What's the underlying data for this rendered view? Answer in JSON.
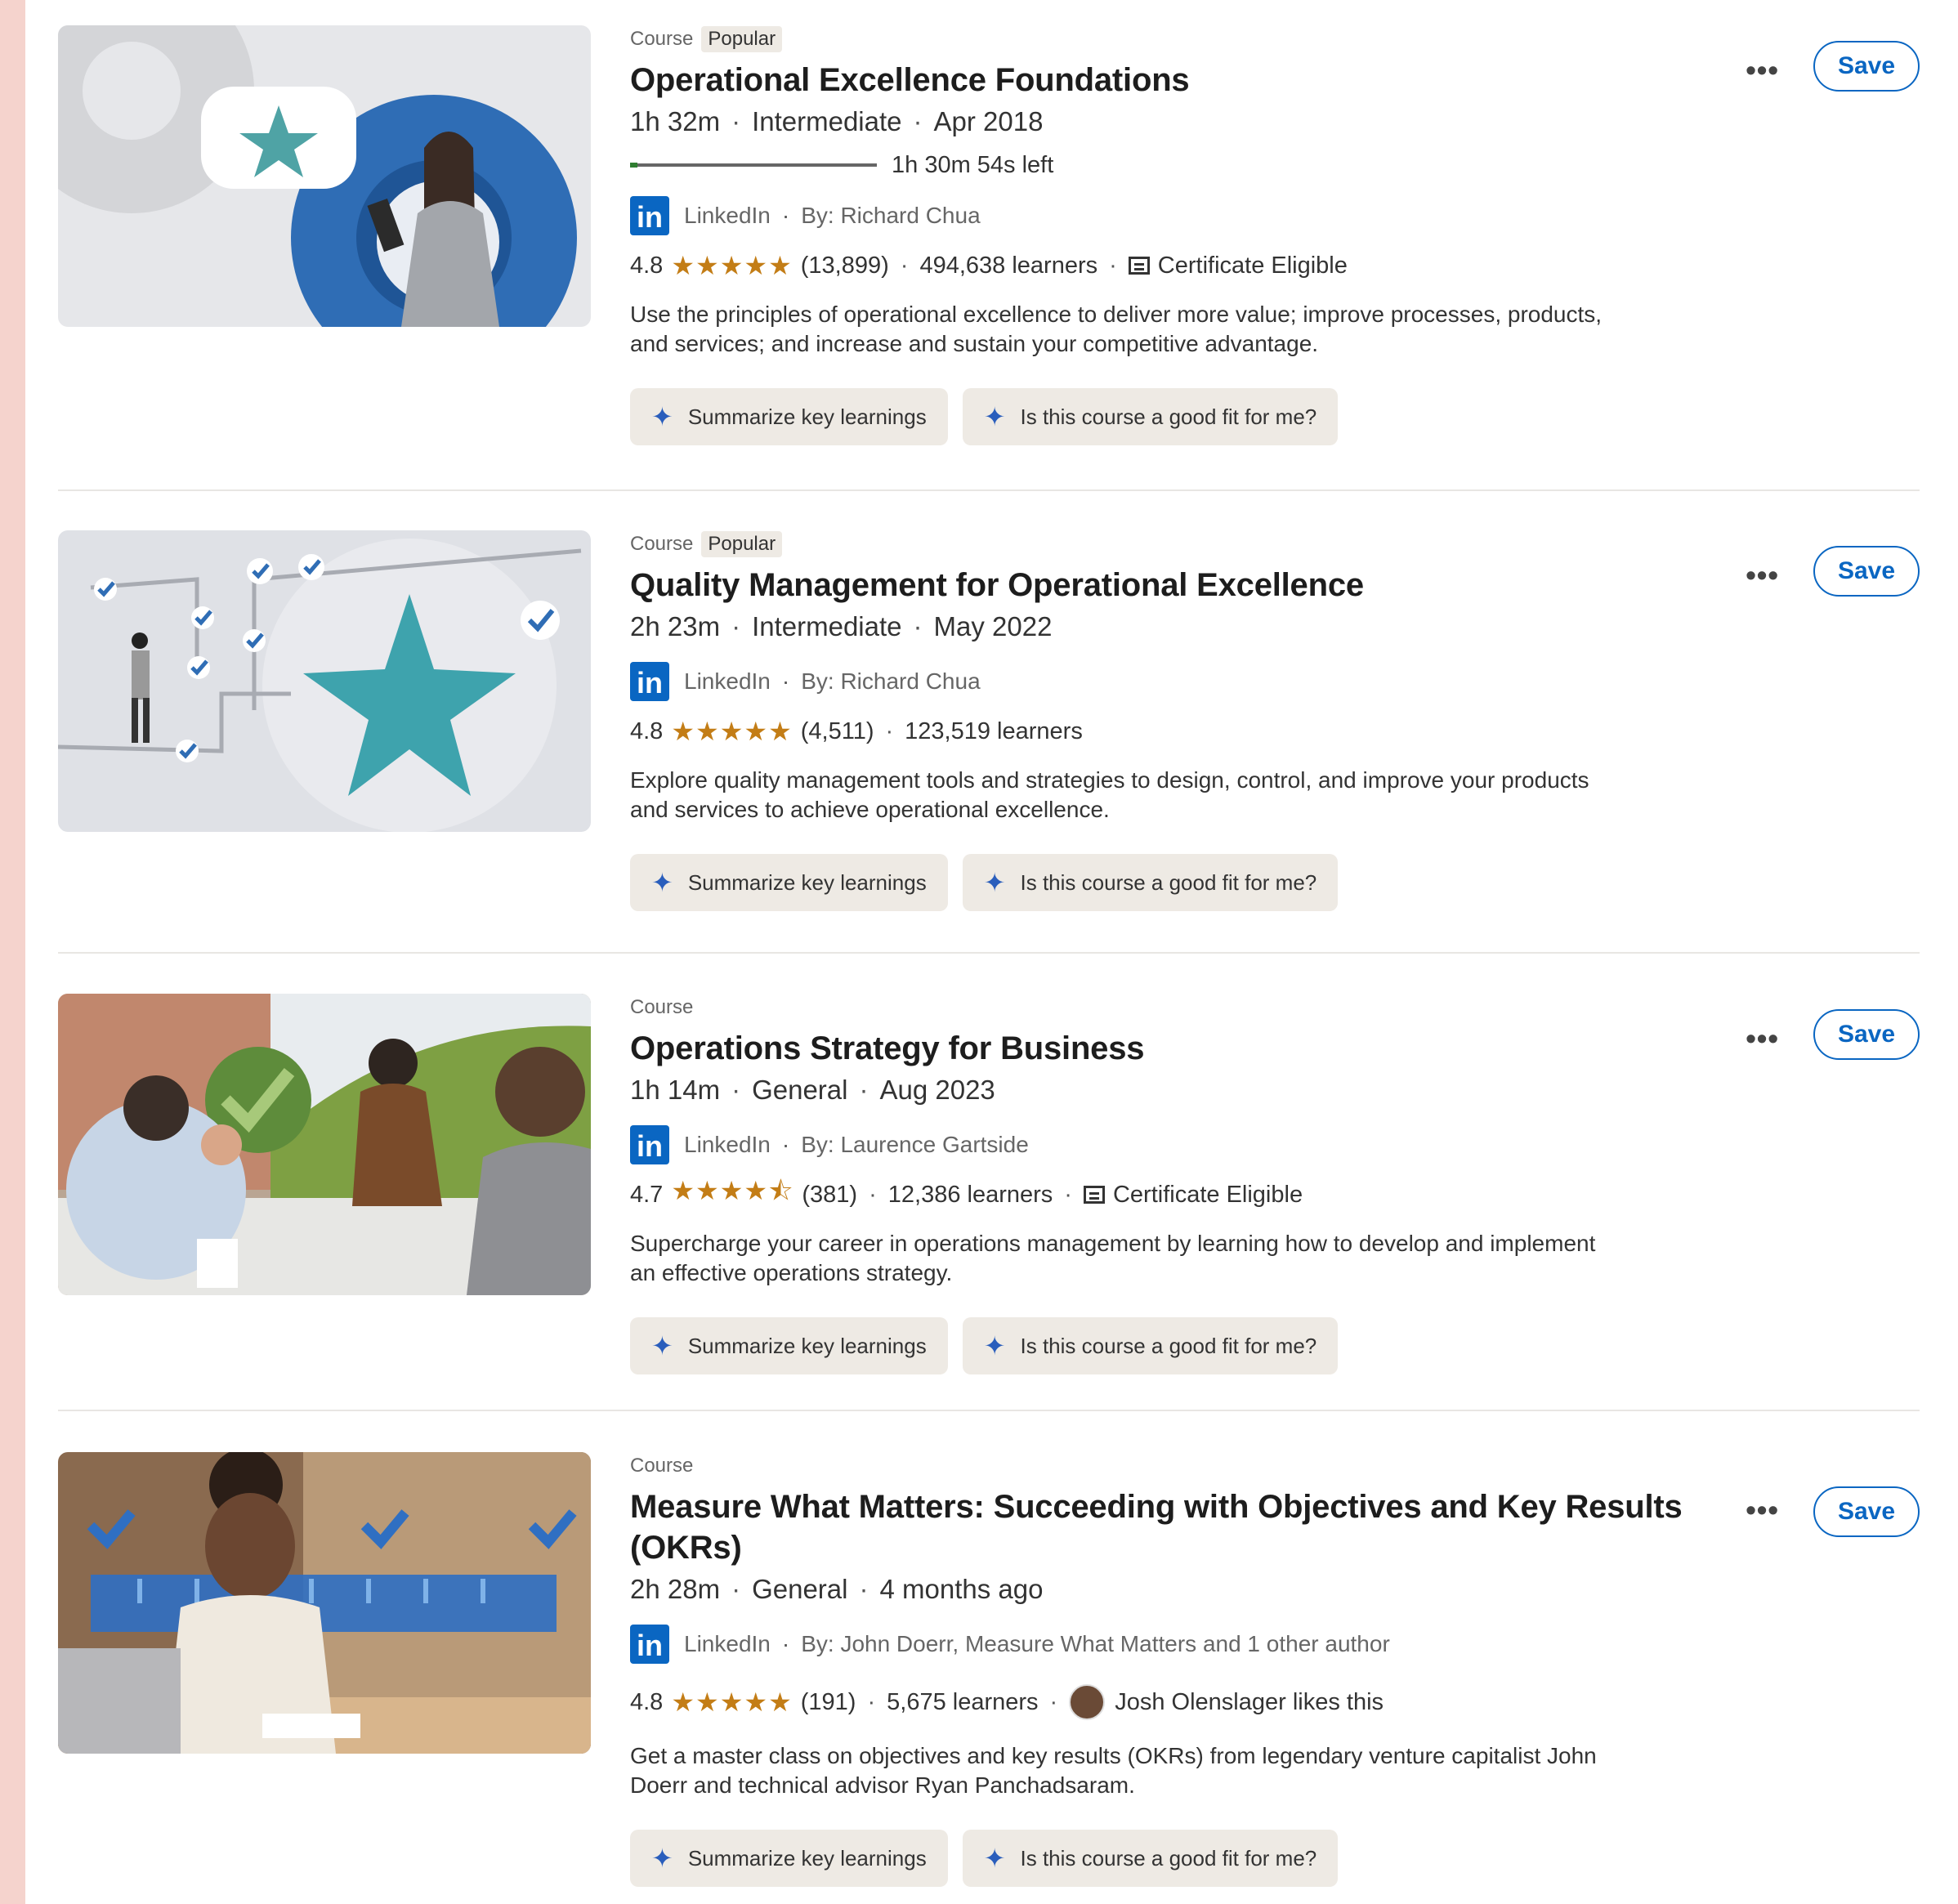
{
  "courses": [
    {
      "type": "Course",
      "badge": "Popular",
      "title": "Operational Excellence Foundations",
      "duration": "1h 32m",
      "level": "Intermediate",
      "date": "Apr 2018",
      "progress_fraction": 0.03,
      "progress_text": "1h 30m 54s left",
      "provider": "LinkedIn",
      "author": "By: Richard Chua",
      "rating": "4.8",
      "stars": "★★★★★",
      "reviews": "(13,899)",
      "learners": "494,638 learners",
      "certificate": "Certificate Eligible",
      "description": "Use the principles of operational excellence to deliver more value; improve processes, products, and services; and increase and sustain your competitive advantage.",
      "chip1": "Summarize key learnings",
      "chip2": "Is this course a good fit for me?",
      "more": "•••",
      "save": "Save"
    },
    {
      "type": "Course",
      "badge": "Popular",
      "title": "Quality Management for Operational Excellence",
      "duration": "2h 23m",
      "level": "Intermediate",
      "date": "May 2022",
      "provider": "LinkedIn",
      "author": "By: Richard Chua",
      "rating": "4.8",
      "stars": "★★★★★",
      "reviews": "(4,511)",
      "learners": "123,519 learners",
      "description": "Explore quality management tools and strategies to design, control, and improve your products and services to achieve operational excellence.",
      "chip1": "Summarize key learnings",
      "chip2": "Is this course a good fit for me?",
      "more": "•••",
      "save": "Save"
    },
    {
      "type": "Course",
      "title": "Operations Strategy for Business",
      "duration": "1h 14m",
      "level": "General",
      "date": "Aug 2023",
      "provider": "LinkedIn",
      "author": "By: Laurence Gartside",
      "rating": "4.7",
      "stars": "★★★★⯪",
      "reviews": "(381)",
      "learners": "12,386 learners",
      "certificate": "Certificate Eligible",
      "description": "Supercharge your career in operations management by learning how to develop and implement an effective operations strategy.",
      "chip1": "Summarize key learnings",
      "chip2": "Is this course a good fit for me?",
      "more": "•••",
      "save": "Save"
    },
    {
      "type": "Course",
      "title": "Measure What Matters: Succeeding with Objectives and Key Results (OKRs)",
      "duration": "2h 28m",
      "level": "General",
      "date": "4 months ago",
      "provider": "LinkedIn",
      "author": "By: John Doerr, Measure What Matters and 1 other author",
      "rating": "4.8",
      "stars": "★★★★★",
      "reviews": "(191)",
      "learners": "5,675 learners",
      "social": "Josh Olenslager likes this",
      "description": "Get a master class on objectives and key results (OKRs) from legendary venture capitalist John Doerr and technical advisor Ryan Panchadsaram.",
      "chip1": "Summarize key learnings",
      "chip2": "Is this course a good fit for me?",
      "more": "•••",
      "save": "Save"
    }
  ],
  "colors": {
    "linkedin_blue": "#0a66c2",
    "star": "#c37d16",
    "chip_bg": "#eeeae4",
    "page_bg": "#f5d3cd"
  },
  "logo_text": "in"
}
